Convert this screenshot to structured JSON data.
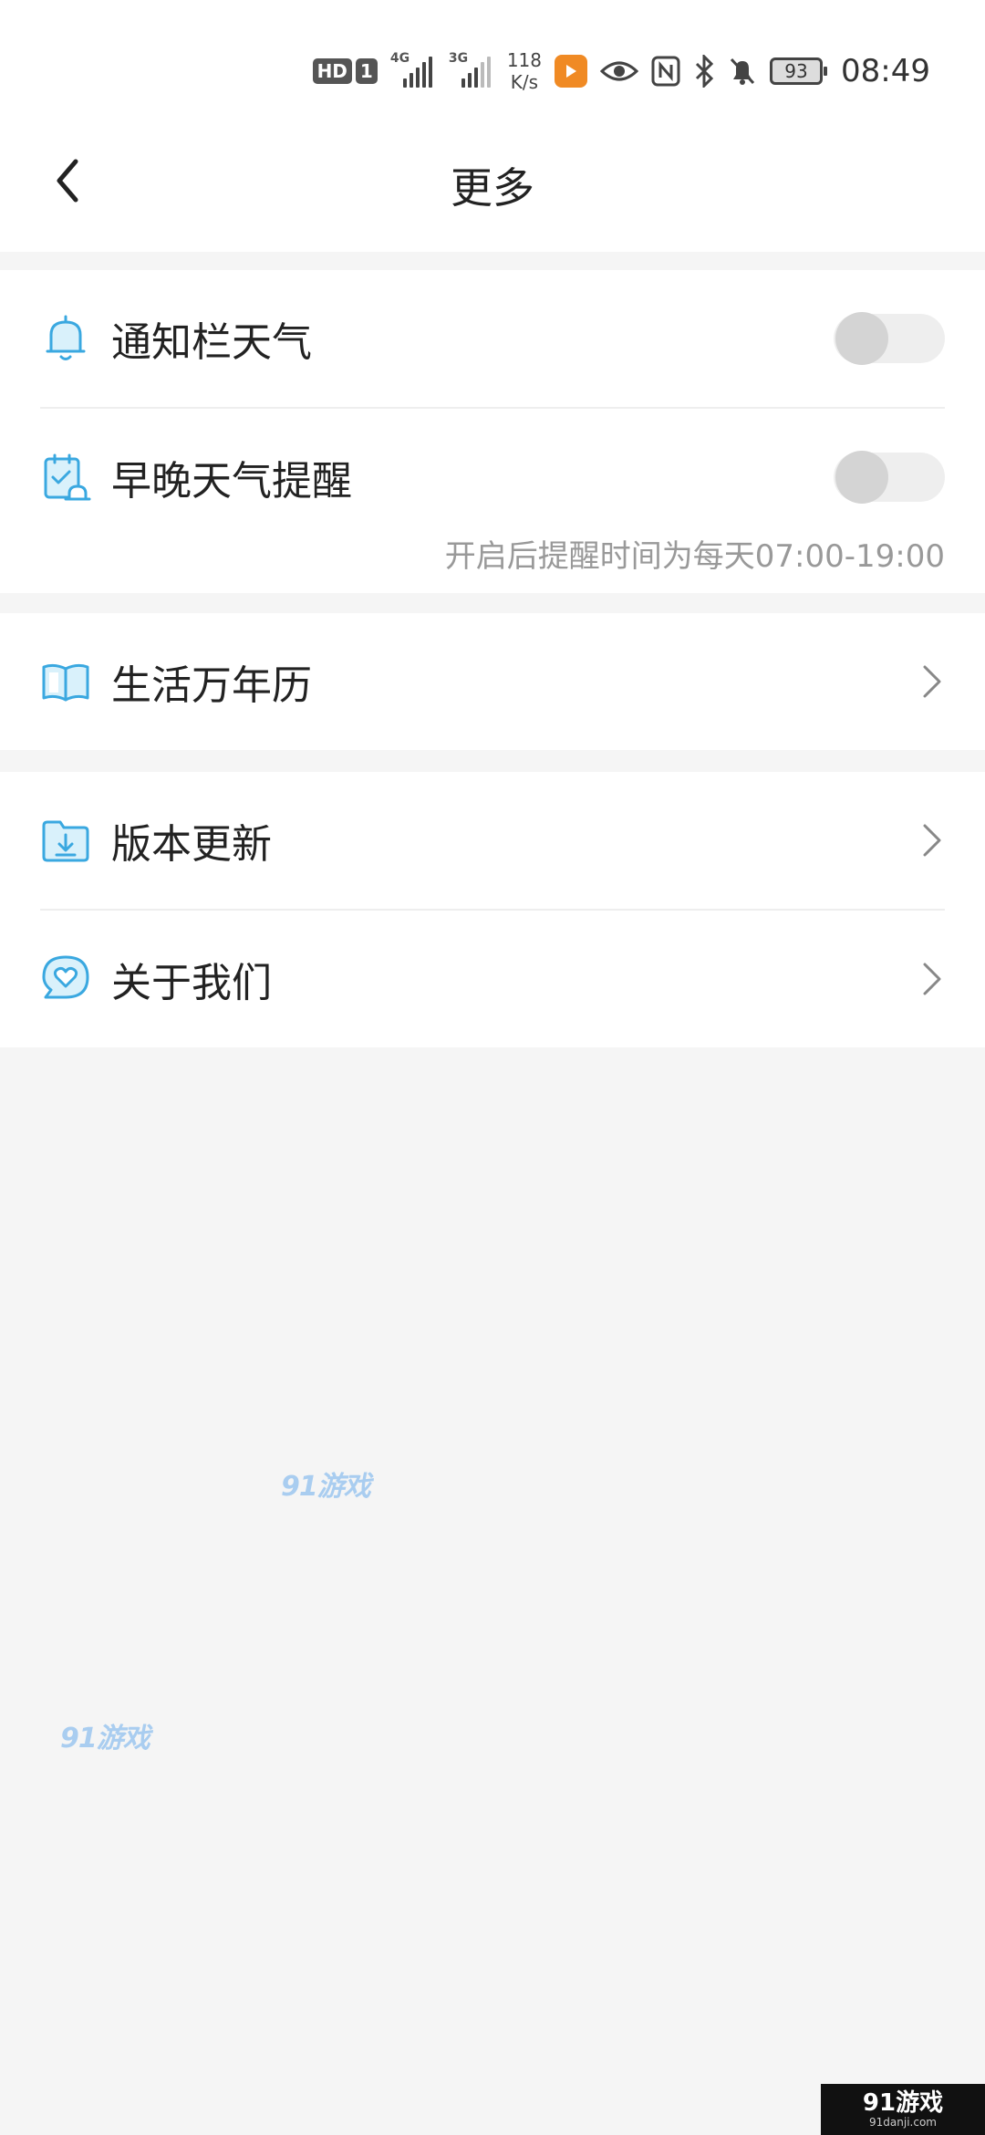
{
  "status_bar": {
    "hd_label": "HD",
    "sim_label": "1",
    "net1": "4G",
    "net2": "3G",
    "speed_value": "118",
    "speed_unit": "K/s",
    "battery": "93",
    "time": "08:49"
  },
  "header": {
    "title": "更多"
  },
  "settings": {
    "notification_weather": {
      "label": "通知栏天气",
      "enabled": false,
      "icon": "bell-icon"
    },
    "weather_reminder": {
      "label": "早晚天气提醒",
      "enabled": false,
      "hint": "开启后提醒时间为每天07:00-19:00",
      "icon": "calendar-alarm-icon"
    },
    "calendar": {
      "label": "生活万年历",
      "icon": "book-icon"
    },
    "update": {
      "label": "版本更新",
      "icon": "download-folder-icon"
    },
    "about": {
      "label": "关于我们",
      "icon": "heart-chat-icon"
    }
  },
  "watermarks": {
    "text": "91游戏",
    "corner_text": "91游戏",
    "corner_sub": "91danji.com"
  },
  "colors": {
    "accent": "#3aa8e0",
    "background": "#f5f5f5"
  }
}
